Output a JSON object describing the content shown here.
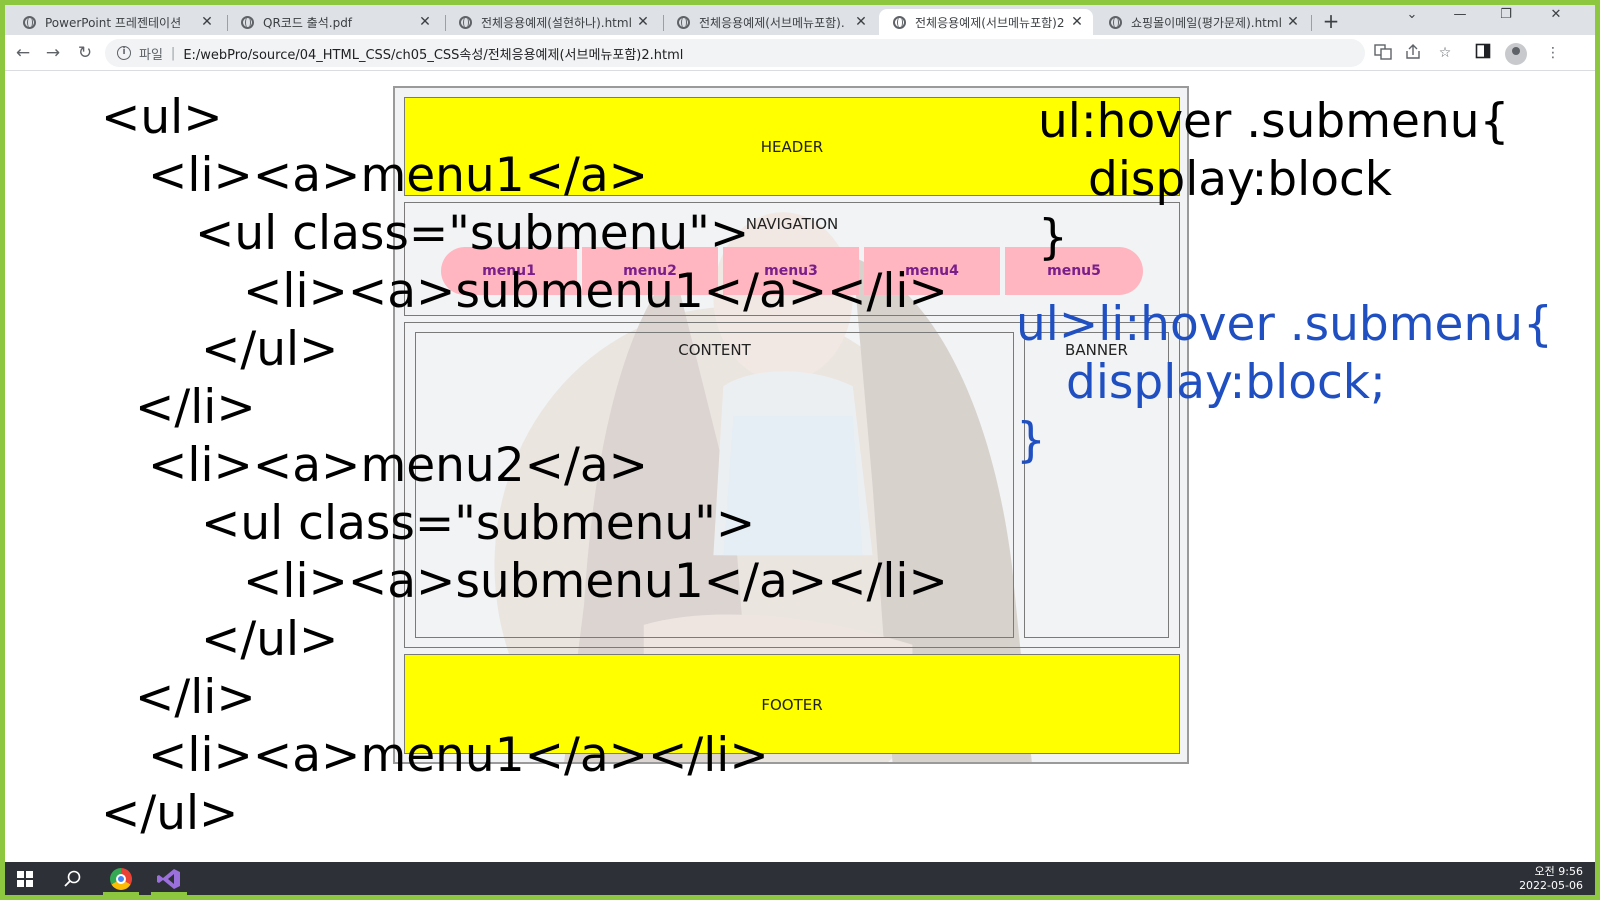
{
  "browser": {
    "tabs": [
      {
        "title": "PowerPoint 프레젠테이션",
        "active": false
      },
      {
        "title": "QR코드 출석.pdf",
        "active": false
      },
      {
        "title": "전체응용예제(설현하나).html",
        "active": false
      },
      {
        "title": "전체응용예제(서브메뉴포함).",
        "active": false
      },
      {
        "title": "전체응용예제(서브메뉴포함)2",
        "active": true
      },
      {
        "title": "쇼핑몰이메일(평가문제).html",
        "active": false
      }
    ],
    "new_tab": "+",
    "address": {
      "scheme": "파일",
      "url": "E:/webPro/source/04_HTML_CSS/ch05_CSS속성/전체응용예제(서브메뉴포함)2.html"
    }
  },
  "demo_page": {
    "header": "HEADER",
    "navigation": "NAVIGATION",
    "menus": [
      "menu1",
      "menu2",
      "menu3",
      "menu4",
      "menu5"
    ],
    "content": "CONTENT",
    "banner": "BANNER",
    "footer": "FOOTER"
  },
  "slide": {
    "code_lines": [
      "<ul>",
      "<li><a>menu1</a>",
      "<ul class=\"submenu\">",
      "<li><a>submenu1</a></li>",
      "</ul>",
      "</li>",
      "<li><a>menu2</a>",
      "<ul class=\"submenu\">",
      "<li><a>submenu1</a></li>",
      "</ul>",
      "</li>",
      "<li><a>menu1</a></li>",
      "</ul>"
    ],
    "css_rule_1": [
      "ul:hover .submenu{",
      "display:block",
      "}"
    ],
    "css_rule_2": [
      "ul>li:hover .submenu{",
      "display:block;",
      "}"
    ]
  },
  "taskbar": {
    "time": "오전 9:56",
    "date": "2022-05-06"
  },
  "colors": {
    "os_border": "#8dc63f",
    "header_footer": "#ffff00",
    "menu_bg": "#ffb6c1",
    "menu_text": "#7a1e8a",
    "css_rule_2": "#1f4fc1"
  }
}
